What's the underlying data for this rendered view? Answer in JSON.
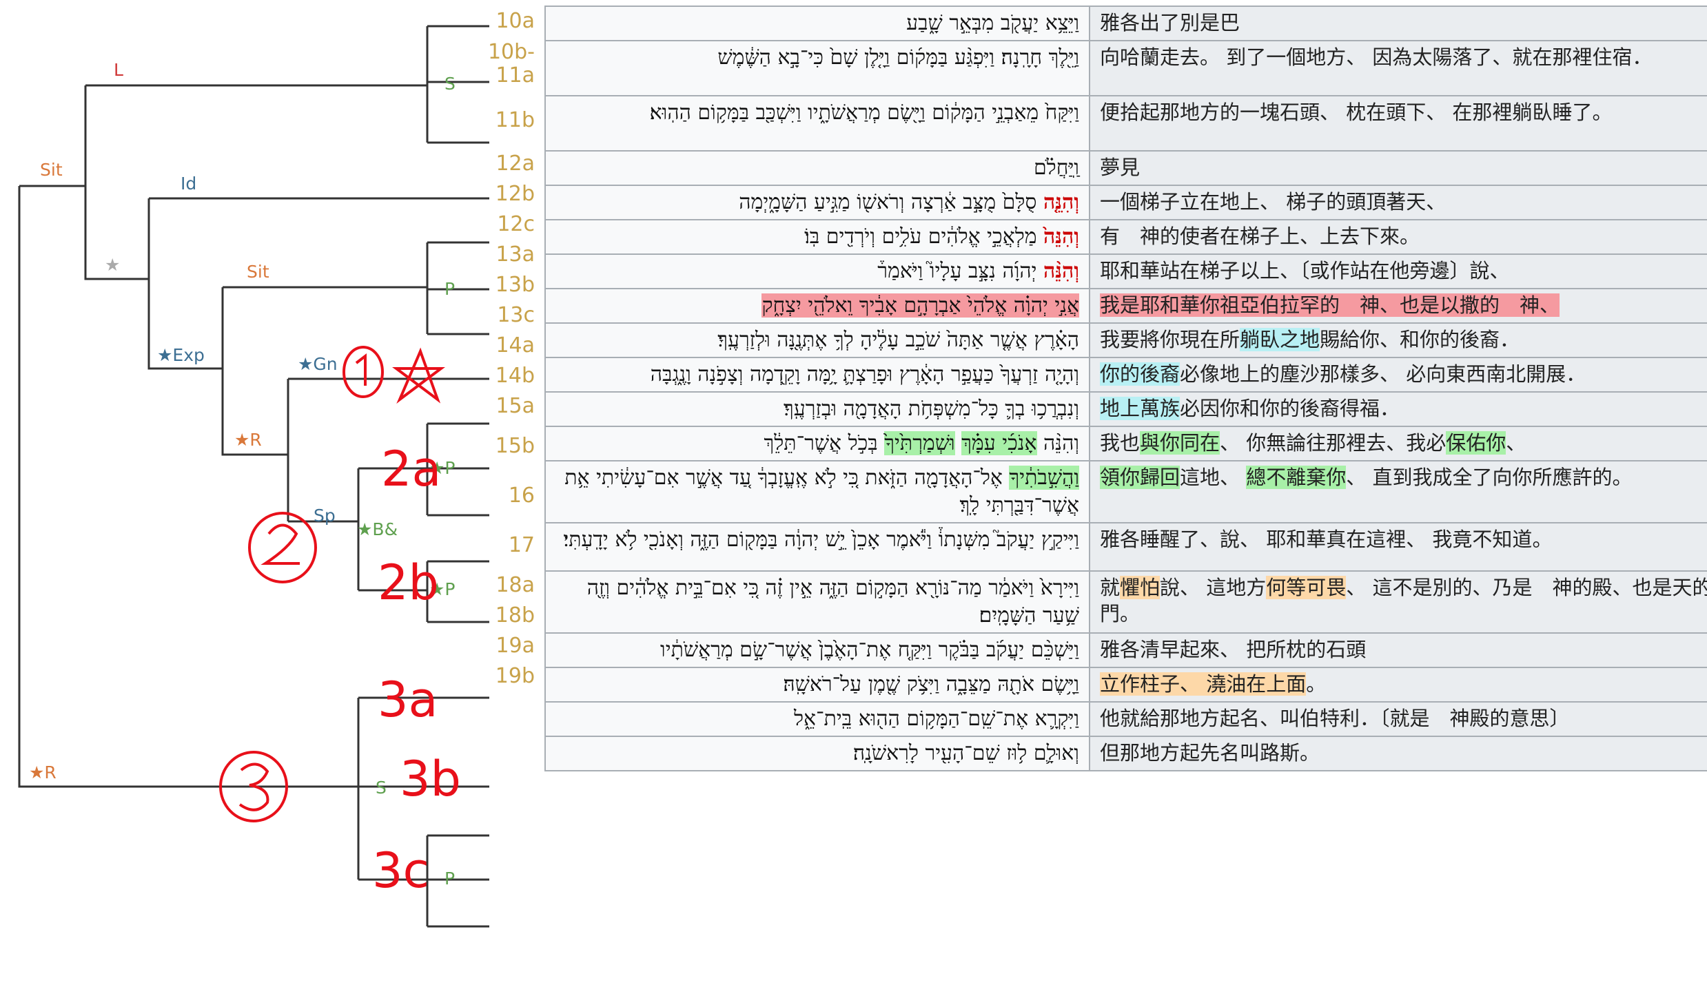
{
  "colors": {
    "line": "#333333",
    "orange": "#d9783a",
    "blue": "#3d6f93",
    "green": "#5fa04f",
    "red_label": "#d03a3a",
    "star": "#aaaaaa",
    "verse": "#c8a24a",
    "annotation": "#e8101a"
  },
  "tree": {
    "node_labels": {
      "L": "L",
      "Sit1": "Sit",
      "S1": "S",
      "Id": "Id",
      "star1": "★",
      "Exp": "★Exp",
      "Sit2": "Sit",
      "P1": "P",
      "Gn": "★Gn",
      "R1": "★R",
      "Sp": "Sp",
      "Bamp": "★B&",
      "P2": "★P",
      "P3": "★P",
      "R2": "★R",
      "S2": "S",
      "P4": "P"
    },
    "annotations": {
      "a1": "①",
      "star": "☆",
      "a2": "②",
      "a2a": "2a",
      "a2b": "2b",
      "a3": "③",
      "a3a": "3a",
      "a3b": "3b",
      "a3c": "3c"
    },
    "verse_labels": [
      "10a",
      "10b-\n11a",
      "11b",
      "12a",
      "12b",
      "12c",
      "13a",
      "13b",
      "13c",
      "14a",
      "14b",
      "15a",
      "15b",
      "16",
      "17",
      "18a",
      "18b",
      "19a",
      "19b"
    ]
  },
  "rows": [
    {
      "verse": "10a",
      "heb": [
        {
          "t": "וַיֵּצֵ֥א יַעֲקֹ֖ב מִבְּאֵ֣ר שָׁ֑בַע"
        }
      ],
      "zh": [
        {
          "t": "雅各出了別是巴"
        }
      ]
    },
    {
      "verse": "10b-11a",
      "heb": [
        {
          "t": "וַיֵּ֖לֶךְ חָרָֽנָה׃ וַיִּפְגַּ֨ע בַּמָּק֜וֹם וַיָּ֤לֶן שָׁם֙ כִּי־בָ֣א הַשֶּׁ֔מֶשׁ"
        }
      ],
      "zh": [
        {
          "t": "向哈蘭走去。 到了一個地方、 因為太陽落了、就在那裡住宿．"
        }
      ]
    },
    {
      "verse": "11b",
      "heb": [
        {
          "t": "וַיִּקַּח֙ מֵאַבְנֵ֣י הַמָּק֔וֹם וַיָּ֖שֶׂם מְרַאֲשֹׁתָ֑יו וַיִּשְׁכַּ֖ב בַּמָּק֥וֹם הַהֽוּא׃"
        }
      ],
      "zh": [
        {
          "t": "便拾起那地方的一塊石頭、 枕在頭下、 在那裡躺臥睡了。"
        }
      ]
    },
    {
      "verse": "12a",
      "heb": [
        {
          "t": "וַֽיַּחֲלֹ֗ם"
        }
      ],
      "zh": [
        {
          "t": "夢見"
        }
      ]
    },
    {
      "verse": "12b",
      "heb": [
        {
          "t": "וְהִנֵּ֤ה",
          "c": "red"
        },
        {
          "t": " סֻלָּם֙ מֻצָּ֣ב אַ֔רְצָה וְרֹאשׁ֖וֹ מַגִּ֣יעַ הַשָּׁמָ֑יְמָה"
        }
      ],
      "zh": [
        {
          "t": "一個梯子立在地上、 梯子的頭頂著天、"
        }
      ]
    },
    {
      "verse": "12c",
      "heb": [
        {
          "t": "וְהִנֵּה֙",
          "c": "red"
        },
        {
          "t": " מַלְאֲכֵ֣י אֱלֹהִ֔ים עֹלִ֥ים וְיֹרְדִ֖ים בּֽוֹ׃"
        }
      ],
      "zh": [
        {
          "t": "有　神的使者在梯子上、上去下來。"
        }
      ]
    },
    {
      "verse": "13a",
      "heb": [
        {
          "t": "וְהִנֵּ֨ה",
          "c": "red"
        },
        {
          "t": " יְהוָ֜ה נִצָּ֣ב עָלָיו֮ וַיֹּאמַר֒"
        }
      ],
      "zh": [
        {
          "t": "耶和華站在梯子以上、〔或作站在他旁邊〕說、"
        }
      ]
    },
    {
      "verse": "13b",
      "heb": [
        {
          "t": "אֲנִ֣י יְהוָ֗ה אֱלֹהֵי֙ אַבְרָהָ֣ם אָבִ֔יךָ וֵאלֹהֵ֖י יִצְחָ֑ק",
          "c": "hl-red"
        }
      ],
      "zh": [
        {
          "t": "我是耶和華你祖亞伯拉罕的　神、也是以撒的　神、",
          "c": "hl-red"
        }
      ]
    },
    {
      "verse": "13c",
      "heb": [
        {
          "t": "הָאָ֗רֶץ אֲשֶׁ֤ר אַתָּה֙ שֹׁכֵ֣ב עָלֶ֔יהָ לְךָ֥ אֶתְּנֶ֖נָּה וּלְזַרְעֶֽךָ׃"
        }
      ],
      "zh": [
        {
          "t": "我要將你現在所"
        },
        {
          "t": "躺臥之地",
          "c": "hl-cyan"
        },
        {
          "t": "賜給你、和你的後裔．"
        }
      ]
    },
    {
      "verse": "14a",
      "heb": [
        {
          "t": "וְהָיָ֤ה זַרְעֲךָ֙ כַּעֲפַ֣ר הָאָ֔רֶץ וּפָרַצְתָּ֛ יָ֥מָּה וָקֵ֖דְמָה וְצָפֹ֣נָה וָנֶ֑גְבָּה"
        }
      ],
      "zh": [
        {
          "t": "你的後裔",
          "c": "hl-cyan"
        },
        {
          "t": "必像地上的塵沙那樣多、 必向東西南北開展．"
        }
      ]
    },
    {
      "verse": "14b",
      "heb": [
        {
          "t": "וְנִבְרֲכ֥וּ בְךָ֛ כָּל־מִשְׁפְּחֹ֥ת הָאֲדָמָ֖ה וּבְזַרְעֶֽךָ׃"
        }
      ],
      "zh": [
        {
          "t": "地上萬族",
          "c": "hl-cyan"
        },
        {
          "t": "必因你和你的後裔得福．"
        }
      ]
    },
    {
      "verse": "15a",
      "heb": [
        {
          "t": "וְהִנֵּ֨ה "
        },
        {
          "t": "אָנֹכִ֜י עִמָּ֗ךְ",
          "c": "hl-green"
        },
        {
          "t": " "
        },
        {
          "t": "וּשְׁמַרְתִּ֙יךָ֙",
          "c": "hl-green"
        },
        {
          "t": " בְּכֹ֣ל אֲשֶׁר־תֵּלֵ֔ךְ"
        }
      ],
      "zh": [
        {
          "t": "我也"
        },
        {
          "t": "與你同在",
          "c": "hl-green"
        },
        {
          "t": "、 你無論往那裡去、我必"
        },
        {
          "t": "保佑你",
          "c": "hl-green"
        },
        {
          "t": "、"
        }
      ]
    },
    {
      "verse": "15b",
      "heb": [
        {
          "t": "וַהֲשִׁ֣בֹתִ֔יךָ",
          "c": "hl-green"
        },
        {
          "t": " אֶל־הָאֲדָמָ֖ה הַזֹּ֑את כִּ֚י לֹ֣א אֶֽעֱזָבְךָ֔ עַ֚ד אֲשֶׁ֣ר אִם־עָשִׂ֔יתִי אֵ֥ת אֲשֶׁר־דִּבַּ֖רְתִּי לָֽךְ׃"
        }
      ],
      "zh": [
        {
          "t": "領你歸回",
          "c": "hl-green"
        },
        {
          "t": "這地、 "
        },
        {
          "t": "總不離棄你",
          "c": "hl-green"
        },
        {
          "t": "、 直到我成全了向你所應許的。"
        }
      ]
    },
    {
      "verse": "16",
      "heb": [
        {
          "t": "וַיִּיקַ֣ץ יַעֲקֹב֮ מִשְּׁנָתוֹ֒ וַיֹּ֕אמֶר אָכֵן֙ יֵ֣שׁ יְהוָ֔ה בַּמָּק֖וֹם הַזֶּ֑ה וְאָנֹכִ֖י לֹ֥א יָדָֽעְתִּי׃"
        }
      ],
      "zh": [
        {
          "t": "雅各睡醒了、說、 耶和華真在這裡、 我竟不知道。"
        }
      ]
    },
    {
      "verse": "17",
      "heb": [
        {
          "t": "וַיִּירָא֙ וַיֹּאמַ֔ר מַה־נּוֹרָ֖א הַמָּק֣וֹם הַזֶּ֑ה אֵ֣ין זֶ֗ה כִּ֚י אִם־בֵּ֣ית אֱלֹהִ֔ים וְזֶ֖ה שַׁ֥עַר הַשָּׁמָֽיִם׃"
        }
      ],
      "zh": [
        {
          "t": "就"
        },
        {
          "t": "懼怕",
          "c": "hl-orange"
        },
        {
          "t": "說、 這地方"
        },
        {
          "t": "何等可畏",
          "c": "hl-orange"
        },
        {
          "t": "、 這不是別的、乃是　神的殿、也是天的門。"
        }
      ]
    },
    {
      "verse": "18a",
      "heb": [
        {
          "t": "וַיַּשְׁכֵּ֨ם יַעֲקֹ֜ב בַּבֹּ֗קֶר וַיִּקַּ֤ח אֶת־הָאֶ֙בֶן֙ אֲשֶׁר־שָׂ֣ם מְרַאֲשֹׁתָ֔יו"
        }
      ],
      "zh": [
        {
          "t": "雅各清早起來、 把所枕的石頭"
        }
      ]
    },
    {
      "verse": "18b",
      "heb": [
        {
          "t": "וַיָּ֥שֶׂם אֹתָ֖הּ מַצֵּבָ֑ה וַיִּצֹ֥ק שֶׁ֖מֶן עַל־רֹאשָֽׁהּ׃"
        }
      ],
      "zh": [
        {
          "t": "立作柱子、 澆油在上面",
          "c": "hl-orange"
        },
        {
          "t": "。"
        }
      ]
    },
    {
      "verse": "19a",
      "heb": [
        {
          "t": "וַיִּקְרָ֛א אֶת־שֵֽׁם־הַמָּק֥וֹם הַה֖וּא בֵּֽית־אֵ֑ל"
        }
      ],
      "zh": [
        {
          "t": "他就給那地方起名、叫伯特利．〔就是　神殿的意思〕"
        }
      ]
    },
    {
      "verse": "19b",
      "heb": [
        {
          "t": "וְאוּלָ֛ם ל֥וּז שֵׁם־הָעִ֖יר לָרִאשֹׁנָֽה׃"
        }
      ],
      "zh": [
        {
          "t": "但那地方起先名叫路斯。"
        }
      ]
    }
  ]
}
